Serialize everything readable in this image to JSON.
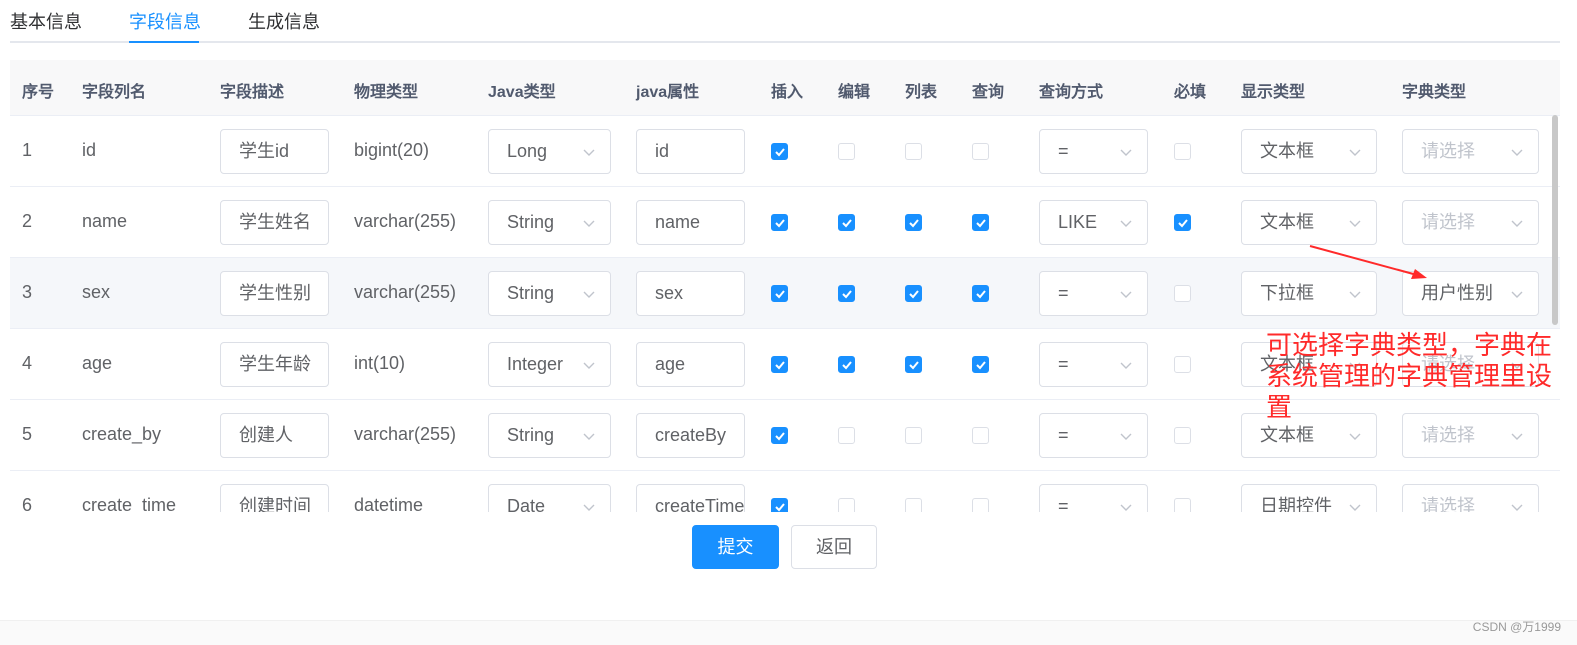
{
  "tabs": [
    {
      "label": "基本信息",
      "active": false
    },
    {
      "label": "字段信息",
      "active": true
    },
    {
      "label": "生成信息",
      "active": false
    }
  ],
  "columns": [
    "序号",
    "字段列名",
    "字段描述",
    "物理类型",
    "Java类型",
    "java属性",
    "插入",
    "编辑",
    "列表",
    "查询",
    "查询方式",
    "必填",
    "显示类型",
    "字典类型"
  ],
  "rows": [
    {
      "index": "1",
      "column": "id",
      "desc": "学生id",
      "physical": "bigint(20)",
      "java_type": "Long",
      "java_field": "id",
      "insert": true,
      "edit": false,
      "list": false,
      "query": false,
      "query_type": "=",
      "required": false,
      "html_type": "文本框",
      "dict_type": "请选择",
      "dict_placeholder": true
    },
    {
      "index": "2",
      "column": "name",
      "desc": "学生姓名",
      "physical": "varchar(255)",
      "java_type": "String",
      "java_field": "name",
      "insert": true,
      "edit": true,
      "list": true,
      "query": true,
      "query_type": "LIKE",
      "required": true,
      "html_type": "文本框",
      "dict_type": "请选择",
      "dict_placeholder": true
    },
    {
      "index": "3",
      "column": "sex",
      "desc": "学生性别",
      "physical": "varchar(255)",
      "java_type": "String",
      "java_field": "sex",
      "insert": true,
      "edit": true,
      "list": true,
      "query": true,
      "query_type": "=",
      "required": false,
      "html_type": "下拉框",
      "dict_type": "用户性别",
      "dict_placeholder": false
    },
    {
      "index": "4",
      "column": "age",
      "desc": "学生年龄",
      "physical": "int(10)",
      "java_type": "Integer",
      "java_field": "age",
      "insert": true,
      "edit": true,
      "list": true,
      "query": true,
      "query_type": "=",
      "required": false,
      "html_type": "文本框",
      "dict_type": "请选择",
      "dict_placeholder": true
    },
    {
      "index": "5",
      "column": "create_by",
      "desc": "创建人",
      "physical": "varchar(255)",
      "java_type": "String",
      "java_field": "createBy",
      "insert": true,
      "edit": false,
      "list": false,
      "query": false,
      "query_type": "=",
      "required": false,
      "html_type": "文本框",
      "dict_type": "请选择",
      "dict_placeholder": true
    },
    {
      "index": "6",
      "column": "create_time",
      "desc": "创建时间",
      "physical": "datetime",
      "java_type": "Date",
      "java_field": "createTime",
      "insert": true,
      "edit": false,
      "list": false,
      "query": false,
      "query_type": "=",
      "required": false,
      "html_type": "日期控件",
      "dict_type": "请选择",
      "dict_placeholder": true
    }
  ],
  "buttons": {
    "submit": "提交",
    "back": "返回"
  },
  "annotation": "可选择字典类型，字典在系统管理的字典管理里设置",
  "watermark": "CSDN @万1999",
  "colors": {
    "primary": "#1890ff",
    "annotation": "#ff2a2a",
    "border": "#dcdfe6"
  }
}
